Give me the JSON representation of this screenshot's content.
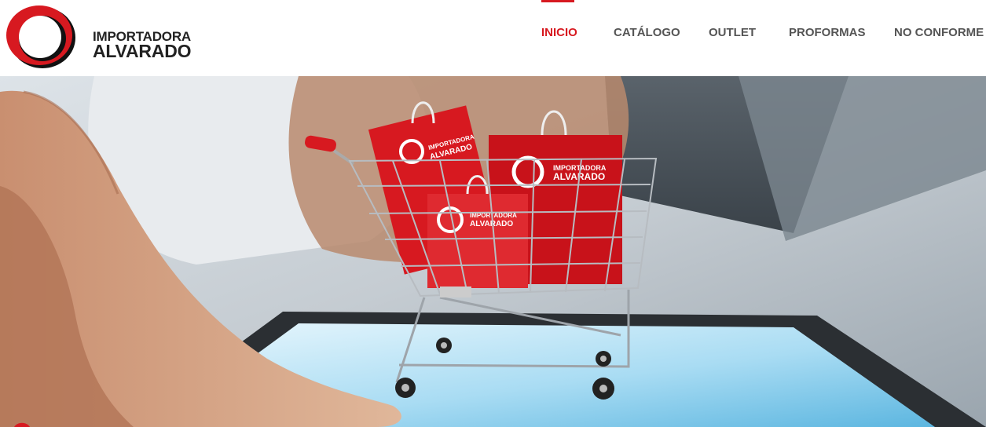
{
  "brand": {
    "line1": "IMPORTADORA",
    "line2": "ALVARADO"
  },
  "nav": {
    "items": [
      {
        "label": "INICIO",
        "active": true
      },
      {
        "label": "CATÁLOGO",
        "active": false
      },
      {
        "label": "OUTLET",
        "active": false
      },
      {
        "label": "PROFORMAS",
        "active": false
      },
      {
        "label": "NO CONFORME",
        "active": false
      }
    ]
  },
  "hero": {
    "bag_brand_line1": "IMPORTADORA",
    "bag_brand_line2": "ALVARADO"
  },
  "colors": {
    "brand_red": "#d71920",
    "nav_text": "#555555",
    "logo_text": "#222222"
  }
}
